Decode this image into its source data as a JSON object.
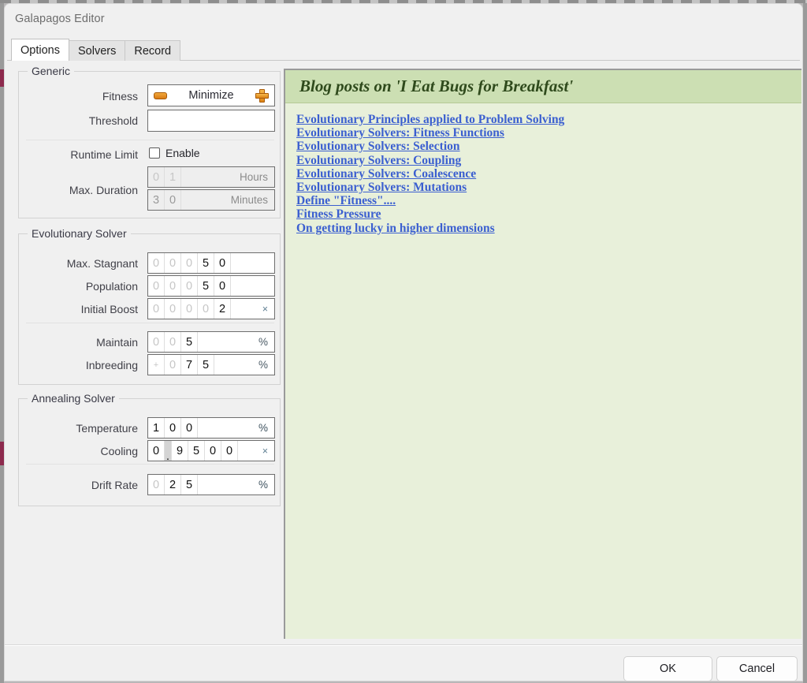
{
  "window": {
    "title": "Galapagos Editor"
  },
  "tabs": [
    {
      "label": "Options",
      "active": true
    },
    {
      "label": "Solvers",
      "active": false
    },
    {
      "label": "Record",
      "active": false
    }
  ],
  "groups": {
    "generic": {
      "title": "Generic",
      "fitness": {
        "label": "Fitness",
        "value": "Minimize",
        "minus_icon": "minus-icon",
        "plus_icon": "plus-icon"
      },
      "threshold": {
        "label": "Threshold",
        "value": ""
      },
      "runtime_limit": {
        "label": "Runtime Limit",
        "checkbox_label": "Enable",
        "checked": false
      },
      "max_duration": {
        "label": "Max. Duration",
        "hours": {
          "digits": [
            "0",
            "1"
          ],
          "dim": [
            true,
            true
          ],
          "unit": "Hours",
          "enabled": false
        },
        "minutes": {
          "digits": [
            "3",
            "0"
          ],
          "dim": [
            true,
            true
          ],
          "unit": "Minutes",
          "enabled": false
        }
      }
    },
    "evolutionary": {
      "title": "Evolutionary Solver",
      "max_stagnant": {
        "label": "Max. Stagnant",
        "digits": [
          "0",
          "0",
          "0",
          "5",
          "0"
        ],
        "dim": [
          true,
          true,
          true,
          false,
          false
        ],
        "unit": ""
      },
      "population": {
        "label": "Population",
        "digits": [
          "0",
          "0",
          "0",
          "5",
          "0"
        ],
        "dim": [
          true,
          true,
          true,
          false,
          false
        ],
        "unit": ""
      },
      "initial_boost": {
        "label": "Initial Boost",
        "digits": [
          "0",
          "0",
          "0",
          "0",
          "2"
        ],
        "dim": [
          true,
          true,
          true,
          true,
          false
        ],
        "unit": "×"
      },
      "maintain": {
        "label": "Maintain",
        "digits": [
          "0",
          "0",
          "5"
        ],
        "dim": [
          true,
          true,
          false
        ],
        "unit": "%"
      },
      "inbreeding": {
        "label": "Inbreeding",
        "sign": "+",
        "digits": [
          "0",
          "7",
          "5"
        ],
        "dim": [
          true,
          false,
          false
        ],
        "unit": "%"
      }
    },
    "annealing": {
      "title": "Annealing Solver",
      "temperature": {
        "label": "Temperature",
        "digits": [
          "1",
          "0",
          "0"
        ],
        "dim": [
          false,
          false,
          false
        ],
        "unit": "%"
      },
      "cooling": {
        "label": "Cooling",
        "digits": [
          "0",
          ".",
          "9",
          "5",
          "0",
          "0"
        ],
        "dim": [
          false,
          false,
          false,
          false,
          false,
          false
        ],
        "unit": "×"
      },
      "drift_rate": {
        "label": "Drift Rate",
        "digits": [
          "0",
          "2",
          "5"
        ],
        "dim": [
          true,
          false,
          false
        ],
        "unit": "%"
      }
    }
  },
  "blog": {
    "header": "Blog posts on 'I Eat Bugs for Breakfast'",
    "links": [
      "Evolutionary Principles applied to Problem Solving",
      "Evolutionary Solvers: Fitness Functions",
      "Evolutionary Solvers: Selection",
      "Evolutionary Solvers: Coupling",
      "Evolutionary Solvers: Coalescence",
      "Evolutionary Solvers: Mutations",
      "Define \"Fitness\"....",
      "Fitness Pressure",
      "On getting lucky in higher dimensions"
    ]
  },
  "footer": {
    "ok_label": "OK",
    "cancel_label": "Cancel"
  },
  "colors": {
    "accent_orange": "#dd8416",
    "link_blue": "#3b5fd0",
    "panel_green": "#e8f0da",
    "header_green": "#ccdfb3",
    "header_text_green": "#2f4a1c"
  }
}
